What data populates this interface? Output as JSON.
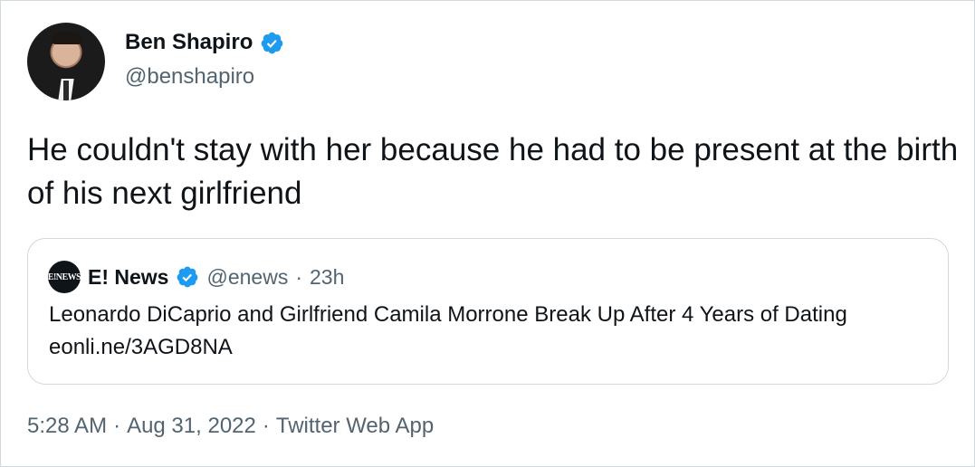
{
  "author": {
    "display_name": "Ben Shapiro",
    "handle": "@benshapiro",
    "verified_icon": "verified-badge-icon",
    "avatar_icon": "profile-photo"
  },
  "tweet": {
    "text": "He couldn't stay with her because he had to be present at the birth of his next girlfriend"
  },
  "quoted_tweet": {
    "avatar_text": "E!NEWS",
    "display_name": "E! News",
    "handle": "@enews",
    "separator": "·",
    "time": "23h",
    "text": "Leonardo DiCaprio and Girlfriend Camila Morrone Break Up After 4 Years of Dating eonli.ne/3AGD8NA"
  },
  "meta": {
    "time": "5:28 AM",
    "sep1": "·",
    "date": "Aug 31, 2022",
    "sep2": "·",
    "source": "Twitter Web App"
  },
  "colors": {
    "text_primary": "#0f1419",
    "text_secondary": "#536471",
    "verified_blue": "#1d9bf0",
    "border": "#cfd9de"
  }
}
